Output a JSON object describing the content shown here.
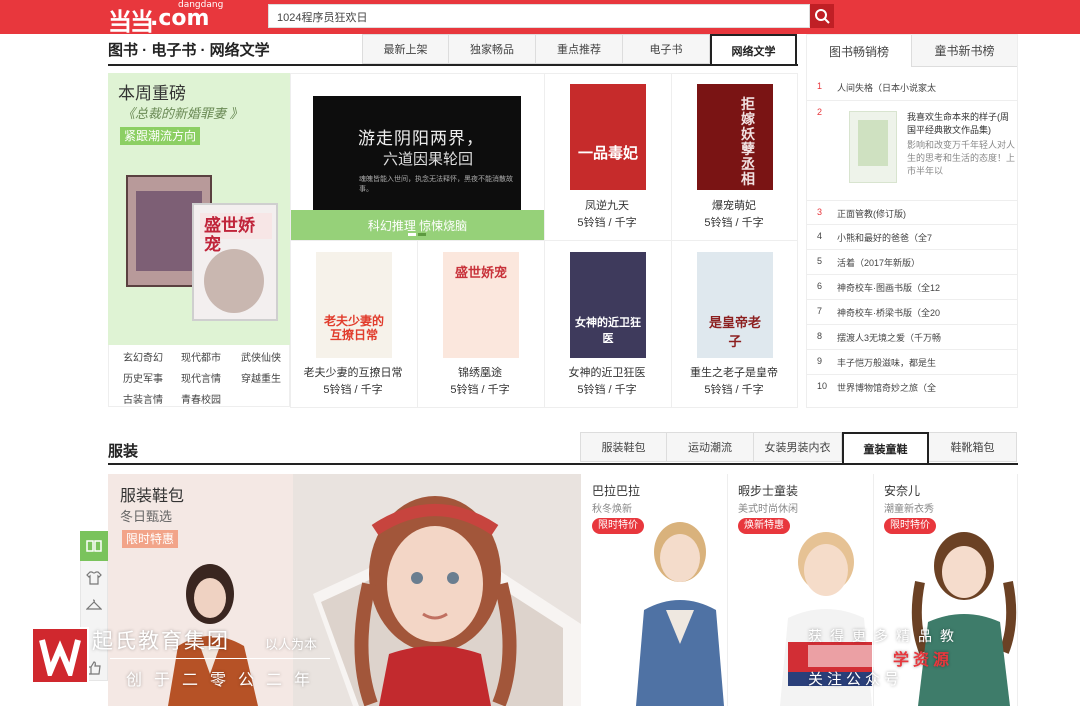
{
  "header": {
    "logo_text": "当当",
    "logo_domain": ".com",
    "logo_small": "dangdang",
    "search_value": "1024程序员狂欢日",
    "search_icon": "search-icon"
  },
  "books": {
    "section_title": "图书 · 电子书 · 网络文学",
    "tabs": [
      "最新上架",
      "独家畅品",
      "重点推荐",
      "电子书",
      "网络文学"
    ],
    "active_tab": "网络文学",
    "feature": {
      "heading": "本周重磅",
      "subtitle": "《总裁的新婚罪妻 》",
      "tag": "紧跟潮流方向"
    },
    "genres": [
      "玄幻奇幻",
      "现代都市",
      "武侠仙侠",
      "历史军事",
      "现代言情",
      "穿越重生",
      "古装言情",
      "青春校园"
    ],
    "banner": {
      "line1": "游走阴阳两界，",
      "line2": "六道因果轮回",
      "line3": "魂魄皆能入世间，执念无法释怀，黑夜不能消散故事。",
      "caption": "科幻推理  惊悚烧脑"
    },
    "items": [
      {
        "title": "凤逆九天",
        "price": "5铃铛 / 千字"
      },
      {
        "title": "爆宠萌妃",
        "price": "5铃铛 / 千字"
      },
      {
        "title": "老夫少妻的互撩日常",
        "price": "5铃铛 / 千字"
      },
      {
        "title": "锦绣凰途",
        "price": "5铃铛 / 千字"
      },
      {
        "title": "女神的近卫狂医",
        "price": "5铃铛 / 千字"
      },
      {
        "title": "重生之老子是皇帝",
        "price": "5铃铛 / 千字"
      }
    ],
    "cover_text": {
      "c1": "一品毒妃",
      "c2": "拒嫁妖孽丞相",
      "c3": "老夫少妻的互撩日常",
      "c4": "盛世娇宠",
      "c5": "女神的近卫狂医",
      "c6": "是皇帝老子"
    }
  },
  "ranking": {
    "tabs": [
      "图书畅销榜",
      "童书新书榜"
    ],
    "items": [
      {
        "n": "1",
        "t": "人间失格（日本小说家太"
      },
      {
        "n": "2",
        "t": "我喜欢生命本来的样子(周"
      },
      {
        "n": "3",
        "t": "正面管教(修订版)"
      },
      {
        "n": "4",
        "t": "小熊和最好的爸爸（全7"
      },
      {
        "n": "5",
        "t": "活着（2017年新版）"
      },
      {
        "n": "6",
        "t": "神奇校车·图画书版（全12"
      },
      {
        "n": "7",
        "t": "神奇校车·桥梁书版（全20"
      },
      {
        "n": "8",
        "t": "摆渡人3无境之爱（千万畅"
      },
      {
        "n": "9",
        "t": "丰子恺万般滋味，都是生"
      },
      {
        "n": "10",
        "t": "世界博物馆奇妙之旅（全"
      }
    ],
    "detail_title": "我喜欢生命本来的样子(周国平经典散文作品集)",
    "detail_desc": "影响和改变万千年轻人对人生的思考和生活的态度！上市半年以"
  },
  "clothing": {
    "section_title": "服装",
    "tabs": [
      "服装鞋包",
      "运动潮流",
      "女装男装内衣",
      "童装童鞋",
      "鞋靴箱包"
    ],
    "active_tab": "童装童鞋",
    "feature": {
      "heading": "服装鞋包",
      "subtitle": "冬日甄选",
      "tag": "限时特惠"
    },
    "brands": [
      {
        "name": "巴拉巴拉",
        "sub": "秋冬焕新",
        "tag": "限时特价"
      },
      {
        "name": "暇步士童装",
        "sub": "美式时尚休闲",
        "tag": "焕新特惠"
      },
      {
        "name": "安奈儿",
        "sub": "潮童新衣秀",
        "tag": "限时特价"
      }
    ]
  },
  "watermark": {
    "org": "起氏教育集团",
    "slogan": "以人为本",
    "founded": "创于二零公二年",
    "r1": "获得更多精品教",
    "r2": "学资源",
    "r3": "关注公众号"
  },
  "colors": {
    "brand_red": "#e8373d",
    "green": "#8ccf63",
    "peach": "#f2a489"
  }
}
